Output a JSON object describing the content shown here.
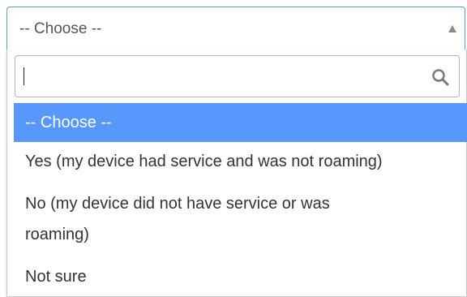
{
  "select": {
    "value": "-- Choose --"
  },
  "search": {
    "value": "",
    "placeholder": ""
  },
  "options": [
    {
      "label": "-- Choose --",
      "highlighted": true
    },
    {
      "label": "Yes (my device had service and was not roaming)",
      "highlighted": false
    },
    {
      "label": "No (my device did not have service or was roaming)",
      "highlighted": false
    },
    {
      "label": "Not sure",
      "highlighted": false
    }
  ],
  "colors": {
    "focus_border": "#5b9dd9",
    "highlight": "#5897fb",
    "text": "#333333"
  },
  "icons": {
    "search": "search-icon",
    "arrow": "arrow-up-icon"
  }
}
